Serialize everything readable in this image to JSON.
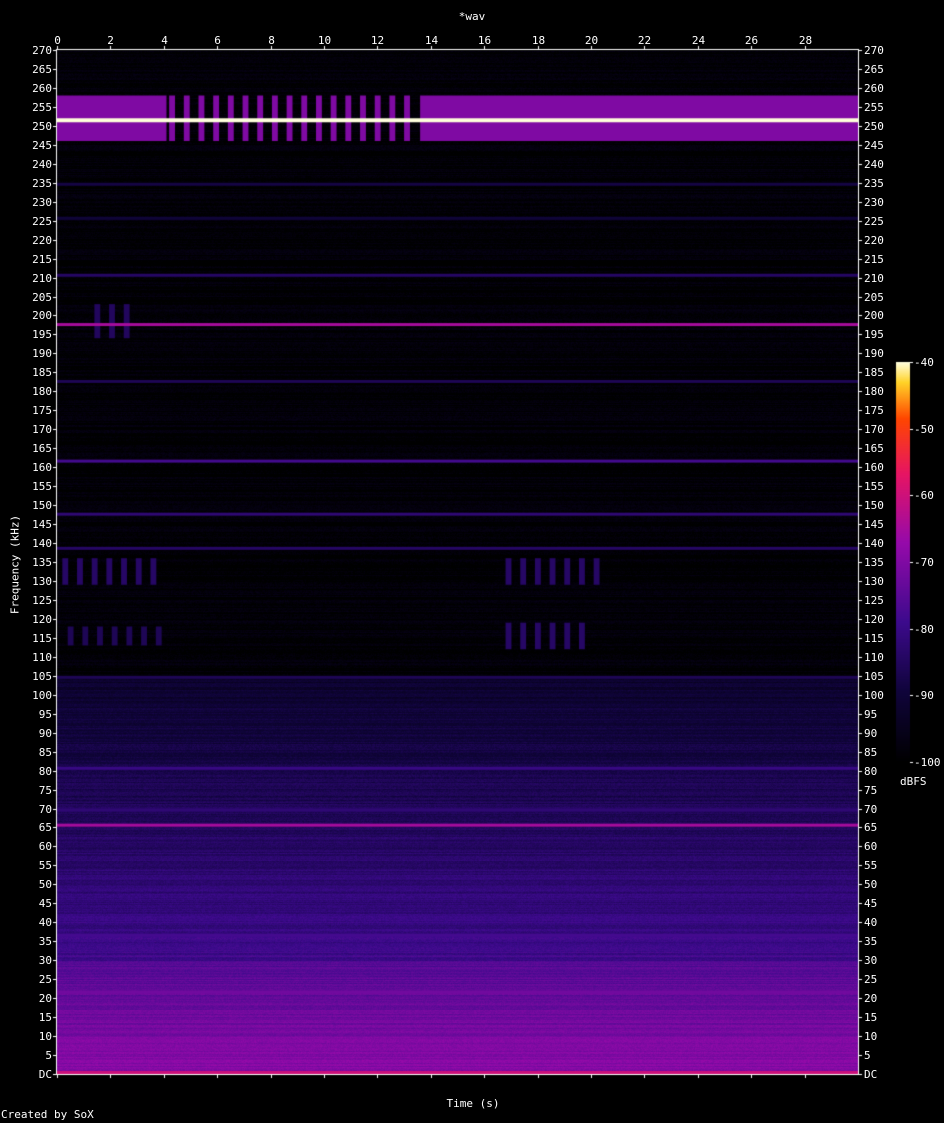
{
  "title": "*wav",
  "footer": "Created by SoX",
  "chart_data": {
    "type": "heatmap",
    "title": "*wav",
    "xlabel": "Time (s)",
    "ylabel": "Frequency (kHz)",
    "xlim": [
      0,
      30
    ],
    "ylim": [
      0,
      270
    ],
    "x_ticks": [
      "0",
      "2",
      "4",
      "6",
      "8",
      "10",
      "12",
      "14",
      "16",
      "18",
      "20",
      "22",
      "24",
      "26",
      "28"
    ],
    "y_ticks": [
      "DC",
      "5",
      "10",
      "15",
      "20",
      "25",
      "30",
      "35",
      "40",
      "45",
      "50",
      "55",
      "60",
      "65",
      "70",
      "75",
      "80",
      "85",
      "90",
      "95",
      "100",
      "105",
      "110",
      "115",
      "120",
      "125",
      "130",
      "135",
      "140",
      "145",
      "150",
      "155",
      "160",
      "165",
      "170",
      "175",
      "180",
      "185",
      "190",
      "195",
      "200",
      "205",
      "210",
      "215",
      "220",
      "225",
      "230",
      "235",
      "240",
      "245",
      "250",
      "255",
      "260",
      "265",
      "270"
    ],
    "colorbar": {
      "label": "dBFS",
      "range": [
        -100,
        -40
      ],
      "ticks": [
        "-40",
        "-50",
        "-60",
        "-70",
        "-80",
        "-90",
        "-100"
      ]
    },
    "colors": {
      "background": "#000000",
      "low": "#000000",
      "mid_low": "#2a0a78",
      "mid": "#7a0aa8",
      "mid_high": "#e0186a",
      "high": "#ff3a00",
      "max": "#ffffd8"
    },
    "tones": [
      {
        "freq_khz": 252,
        "level_dbfs": -40
      },
      {
        "freq_khz": 198,
        "level_dbfs": -65
      },
      {
        "freq_khz": 66,
        "level_dbfs": -65
      },
      {
        "freq_khz": 162,
        "level_dbfs": -78
      },
      {
        "freq_khz": 148,
        "level_dbfs": -82
      },
      {
        "freq_khz": 139,
        "level_dbfs": -84
      },
      {
        "freq_khz": 211,
        "level_dbfs": -84
      },
      {
        "freq_khz": 183,
        "level_dbfs": -86
      },
      {
        "freq_khz": 81,
        "level_dbfs": -80
      },
      {
        "freq_khz": 70,
        "level_dbfs": -82
      },
      {
        "freq_khz": 37,
        "level_dbfs": -78
      },
      {
        "freq_khz": 105,
        "level_dbfs": -86
      },
      {
        "freq_khz": 235,
        "level_dbfs": -88
      },
      {
        "freq_khz": 226,
        "level_dbfs": -90
      },
      {
        "freq_khz": 22,
        "level_dbfs": -72
      },
      {
        "freq_khz": 0,
        "level_dbfs": -60
      }
    ],
    "bursts": [
      {
        "t_start": 4.2,
        "t_end": 13.5,
        "freq_range_khz": [
          246,
          258
        ],
        "level_dbfs": -70,
        "pattern": "intermittent"
      },
      {
        "t_start": 0,
        "t_end": 4.1,
        "freq_range_khz": [
          246,
          258
        ],
        "level_dbfs": -70,
        "pattern": "continuous"
      },
      {
        "t_start": 13.6,
        "t_end": 30,
        "freq_range_khz": [
          246,
          258
        ],
        "level_dbfs": -70,
        "pattern": "continuous"
      },
      {
        "t_start": 1.4,
        "t_end": 3.0,
        "freq_range_khz": [
          194,
          203
        ],
        "level_dbfs": -85,
        "pattern": "intermittent"
      },
      {
        "t_start": 0.2,
        "t_end": 4.0,
        "freq_range_khz": [
          129,
          136
        ],
        "level_dbfs": -84,
        "pattern": "intermittent"
      },
      {
        "t_start": 16.8,
        "t_end": 20.2,
        "freq_range_khz": [
          129,
          136
        ],
        "level_dbfs": -84,
        "pattern": "intermittent"
      },
      {
        "t_start": 0.4,
        "t_end": 4.0,
        "freq_range_khz": [
          113,
          118
        ],
        "level_dbfs": -86,
        "pattern": "intermittent"
      },
      {
        "t_start": 16.8,
        "t_end": 20.0,
        "freq_range_khz": [
          112,
          119
        ],
        "level_dbfs": -84,
        "pattern": "intermittent"
      }
    ]
  }
}
